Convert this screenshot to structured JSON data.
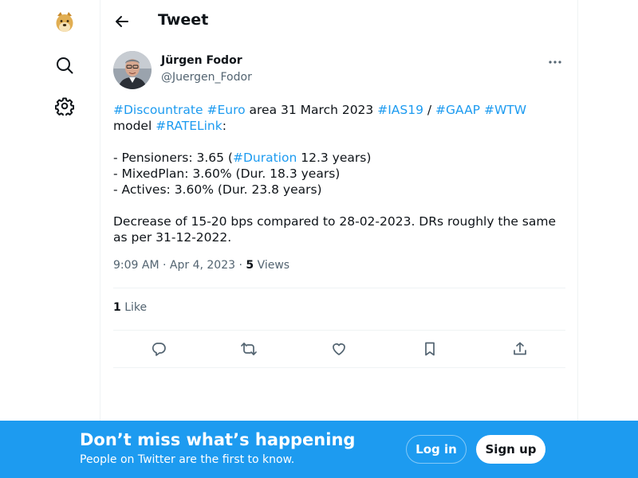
{
  "nav": {
    "logo_icon": "doge-logo-icon",
    "search_icon": "search-icon",
    "settings_icon": "gear-icon"
  },
  "header": {
    "back_icon": "arrow-left-icon",
    "title": "Tweet"
  },
  "tweet": {
    "author_name": "Jürgen Fodor",
    "author_handle": "@Juergen_Fodor",
    "more_icon": "ellipsis-icon",
    "text": {
      "l1_tag1": "#Discountrate",
      "l1_tag2": "#Euro",
      "l1_t1": " area 31 March 2023 ",
      "l1_tag3": "#IAS19",
      "l1_t2": " / ",
      "l1_tag4": "#GAAP",
      "l1_tag5": "#WTW",
      "l2_t1": "model ",
      "l2_tag1": "#RATELink",
      "l2_t2": ":",
      "l3_t1": "- Pensioners: 3.65 (",
      "l3_tag1": "#Duration",
      "l3_t2": " 12.3 years)",
      "l4": "- MixedPlan: 3.60% (Dur. 18.3 years)",
      "l5": "- Actives: 3.60% (Dur. 23.8 years)",
      "l6": "Decrease of 15-20 bps compared to 28-02-2023.  DRs roughly the same",
      "l7": "as per 31-12-2022."
    },
    "time": "9:09 AM",
    "date": "Apr 4, 2023",
    "views_count": "5",
    "views_label": "Views",
    "likes_count": "1",
    "likes_label": "Like"
  },
  "actions": [
    {
      "icon": "reply-icon"
    },
    {
      "icon": "retweet-icon"
    },
    {
      "icon": "like-heart-icon"
    },
    {
      "icon": "bookmark-icon"
    },
    {
      "icon": "share-icon"
    }
  ],
  "banner": {
    "headline": "Don’t miss what’s happening",
    "subtext": "People on Twitter are the first to know.",
    "login_label": "Log in",
    "signup_label": "Sign up"
  },
  "colors": {
    "accent": "#1d9bf0",
    "text_primary": "#0f1419",
    "text_secondary": "#536471",
    "divider": "#eff3f4"
  }
}
